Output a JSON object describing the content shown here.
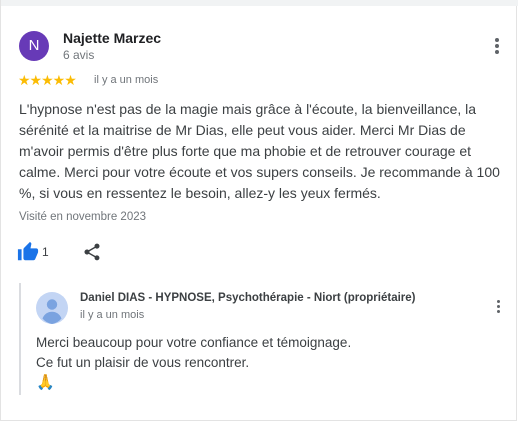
{
  "review": {
    "avatar_initial": "N",
    "author": "Najette Marzec",
    "reviews_count": "6 avis",
    "rating": 5,
    "stars": "★★★★★",
    "time": "il y a un mois",
    "text": "L'hypnose n'est pas de la magie mais grâce à l'écoute, la bienveillance, la sérénité et la maitrise de Mr Dias, elle peut vous aider. Merci Mr Dias de m'avoir permis d'être plus forte que ma phobie et de retrouver courage et calme. Merci pour votre écoute et vos supers conseils. Je recommande à 100 %, si vous en ressentez le besoin, allez-y les yeux fermés.",
    "visited": "Visité en novembre 2023",
    "likes": "1"
  },
  "reply": {
    "author": "Daniel DIAS - HYPNOSE, Psychothérapie - Niort (propriétaire)",
    "time": "il y a un mois",
    "lines": [
      "Merci beaucoup pour votre confiance et témoignage.",
      "Ce fut un plaisir de vous rencontrer."
    ],
    "emoji": "🙏"
  },
  "colors": {
    "avatar": "#673ab7",
    "star": "#fbbc04",
    "like": "#1a73e8",
    "secondary_text": "#70757a"
  },
  "icons": [
    "more-vert-icon",
    "star-icon",
    "thumb-up-icon",
    "share-icon",
    "person-avatar-icon"
  ]
}
